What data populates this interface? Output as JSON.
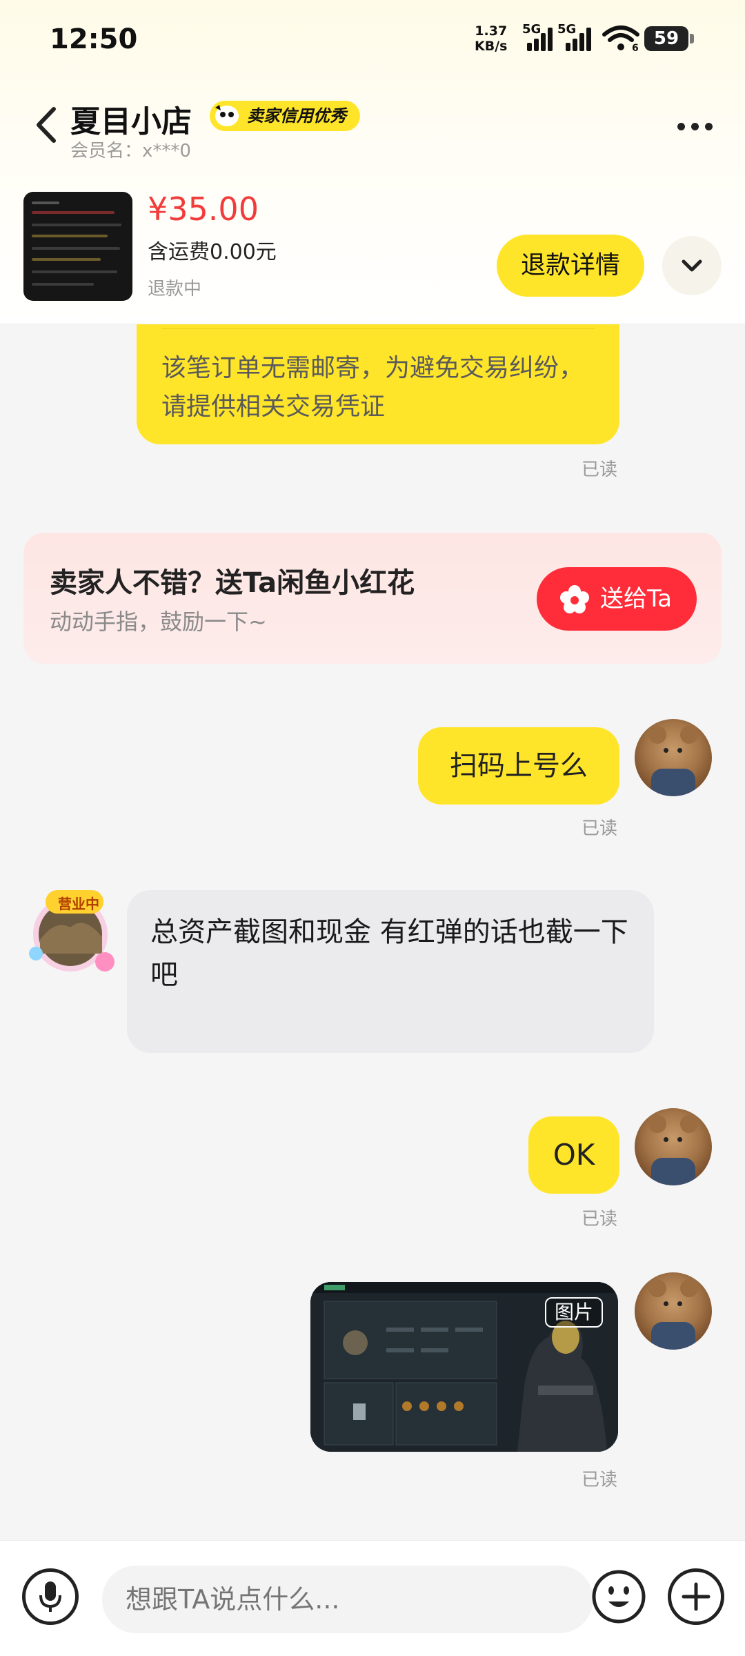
{
  "status_bar": {
    "time": "12:50",
    "net_speed_value": "1.37",
    "net_speed_unit": "KB/s",
    "sim1_tag": "5G",
    "sim2_tag": "5G",
    "wifi_tag": "6",
    "battery": "59"
  },
  "header": {
    "shop_name": "夏目小店",
    "credit_badge": "卖家信用优秀",
    "member_name": "会员名：x***0"
  },
  "order": {
    "price": "¥35.00",
    "shipping": "含运费0.00元",
    "status": "退款中",
    "refund_button": "退款详情"
  },
  "messages": {
    "m1_text": "该笔订单无需邮寄，为避免交易纠纷，请提供相关交易凭证",
    "m1_read": "已读",
    "m2_text": "扫码上号么",
    "m2_read": "已读",
    "m3_text": "总资产截图和现金 有红弹的话也截一下吧",
    "m4_text": "OK",
    "m4_read": "已读",
    "m5_image_label": "图片",
    "m5_read": "已读"
  },
  "seller_badge": "营业中",
  "gift": {
    "title": "卖家人不错？送Ta闲鱼小红花",
    "subtitle": "动动手指，鼓励一下~",
    "button": "送给Ta"
  },
  "input": {
    "placeholder": "想跟TA说点什么..."
  },
  "colors": {
    "accent_yellow": "#ffe52a",
    "price_red": "#f23c3c",
    "gift_red": "#ff2d3a"
  }
}
